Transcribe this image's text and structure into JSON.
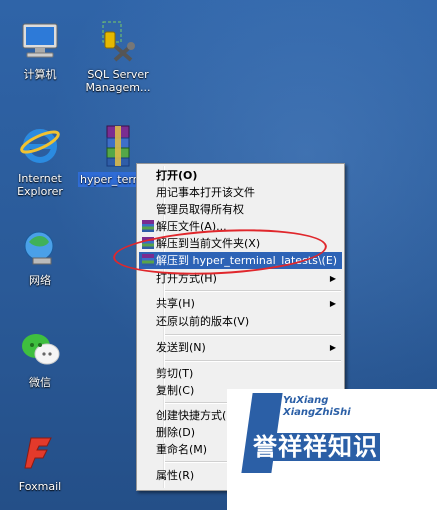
{
  "desktop_icons": [
    {
      "label": "计算机",
      "icon": "computer-icon"
    },
    {
      "label": "SQL Server Managem...",
      "icon": "sql-server-icon"
    },
    {
      "label": "Internet Explorer",
      "icon": "internet-explorer-icon"
    },
    {
      "label": "hyper_terminal_latests.z...",
      "icon": "winrar-archive-icon",
      "selected": true
    },
    {
      "label": "网络",
      "icon": "network-icon"
    },
    {
      "label": "微信",
      "icon": "wechat-icon"
    },
    {
      "label": "Foxmail",
      "icon": "foxmail-icon"
    }
  ],
  "context_menu": {
    "items": [
      {
        "label": "打开(O)",
        "bold": true
      },
      {
        "label": "用记事本打开该文件"
      },
      {
        "label": "管理员取得所有权"
      },
      {
        "label": "解压文件(A)...",
        "icon": "winrar-icon"
      },
      {
        "label": "解压到当前文件夹(X)",
        "icon": "winrar-icon"
      },
      {
        "label": "解压到 hyper_terminal_latests\\(E)",
        "icon": "winrar-icon",
        "highlighted": true
      },
      {
        "label": "打开方式(H)",
        "submenu": true
      },
      {
        "label": "共享(H)",
        "submenu": true
      },
      {
        "label": "还原以前的版本(V)"
      },
      {
        "label": "发送到(N)",
        "submenu": true
      },
      {
        "label": "剪切(T)"
      },
      {
        "label": "复制(C)"
      },
      {
        "label": "创建快捷方式(S)"
      },
      {
        "label": "删除(D)"
      },
      {
        "label": "重命名(M)"
      },
      {
        "label": "属性(R)"
      }
    ]
  },
  "watermark": {
    "english_line1": "YuXiang",
    "english_line2": "XiangZhiShi",
    "chinese": "誉祥祥知识"
  },
  "colors": {
    "highlight": "#2d63b6",
    "annotation_oval": "#e0272c",
    "watermark": "#2b5fa6"
  }
}
